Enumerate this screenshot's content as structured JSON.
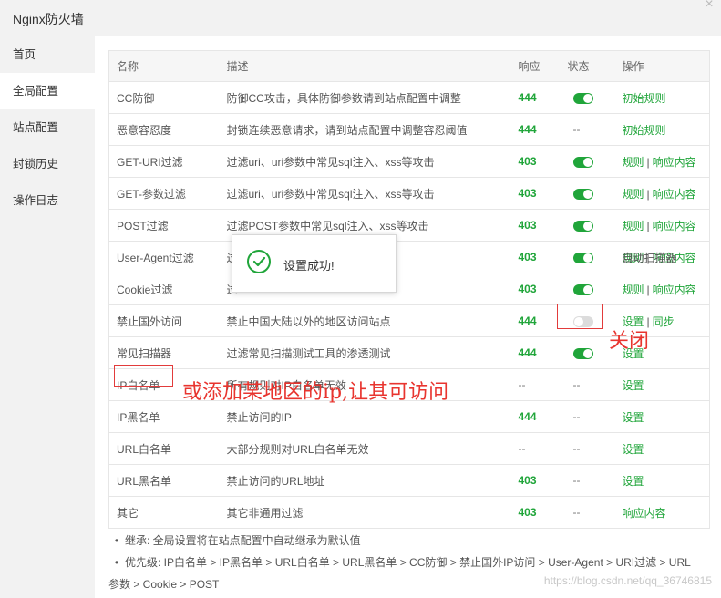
{
  "window": {
    "title": "Nginx防火墙",
    "close_symbol": "×"
  },
  "sidebar": {
    "items": [
      {
        "label": "首页",
        "active": false
      },
      {
        "label": "全局配置",
        "active": true
      },
      {
        "label": "站点配置",
        "active": false
      },
      {
        "label": "封锁历史",
        "active": false
      },
      {
        "label": "操作日志",
        "active": false
      }
    ]
  },
  "table": {
    "headers": {
      "name": "名称",
      "desc": "描述",
      "code": "响应",
      "status": "状态",
      "ops": "操作"
    },
    "rows": [
      {
        "name": "CC防御",
        "desc": "防御CC攻击，具体防御参数请到站点配置中调整",
        "code": "444",
        "status": "on",
        "ops": [
          "初始规则"
        ]
      },
      {
        "name": "恶意容忍度",
        "desc": "封锁连续恶意请求，请到站点配置中调整容忍阈值",
        "code": "444",
        "status": "--",
        "ops": [
          "初始规则"
        ]
      },
      {
        "name": "GET-URI过滤",
        "desc": "过滤uri、uri参数中常见sql注入、xss等攻击",
        "code": "403",
        "status": "on",
        "ops": [
          "规则",
          "响应内容"
        ]
      },
      {
        "name": "GET-参数过滤",
        "desc": "过滤uri、uri参数中常见sql注入、xss等攻击",
        "code": "403",
        "status": "on",
        "ops": [
          "规则",
          "响应内容"
        ]
      },
      {
        "name": "POST过滤",
        "desc": "过滤POST参数中常见sql注入、xss等攻击",
        "code": "403",
        "status": "on",
        "ops": [
          "规则",
          "响应内容"
        ]
      },
      {
        "name": "User-Agent过滤",
        "desc": "过",
        "desc_tail": "自动扫描器",
        "code": "403",
        "status": "on",
        "ops": [
          "规则",
          "响应内容"
        ]
      },
      {
        "name": "Cookie过滤",
        "desc": "过",
        "code": "403",
        "status": "on",
        "ops": [
          "规则",
          "响应内容"
        ]
      },
      {
        "name": "禁止国外访问",
        "desc": "禁止中国大陆以外的地区访问站点",
        "code": "444",
        "status": "off",
        "ops": [
          "设置",
          "同步"
        ]
      },
      {
        "name": "常见扫描器",
        "desc": "过滤常见扫描测试工具的渗透测试",
        "code": "444",
        "status": "on",
        "ops": [
          "设置"
        ]
      },
      {
        "name": "IP白名单",
        "desc": "所有规则对IP白名单无效",
        "code": "--",
        "status": "--",
        "ops": [
          "设置"
        ]
      },
      {
        "name": "IP黑名单",
        "desc": "禁止访问的IP",
        "code": "444",
        "status": "--",
        "ops": [
          "设置"
        ]
      },
      {
        "name": "URL白名单",
        "desc": "大部分规则对URL白名单无效",
        "code": "--",
        "status": "--",
        "ops": [
          "设置"
        ]
      },
      {
        "name": "URL黑名单",
        "desc": "禁止访问的URL地址",
        "code": "403",
        "status": "--",
        "ops": [
          "设置"
        ]
      },
      {
        "name": "其它",
        "desc": "其它非通用过滤",
        "code": "403",
        "status": "--",
        "ops": [
          "响应内容"
        ]
      }
    ]
  },
  "notes": [
    {
      "bullet": "•",
      "text": "继承: 全局设置将在站点配置中自动继承为默认值"
    },
    {
      "bullet": "•",
      "text": "优先级: IP白名单 > IP黑名单 > URL白名单 > URL黑名单 > CC防御 > 禁止国外IP访问 > User-Agent > URI过滤 > URL"
    },
    {
      "bullet": "",
      "text": "参数 > Cookie > POST"
    }
  ],
  "toast": {
    "message": "设置成功!"
  },
  "annotations": {
    "close_label": "关闭",
    "whitelist_tip": "或添加某地区的ip,让其可访问"
  },
  "watermark": "https://blog.csdn.net/qq_36746815",
  "colors": {
    "accent": "#20a53a",
    "annotation": "#e8352f"
  }
}
